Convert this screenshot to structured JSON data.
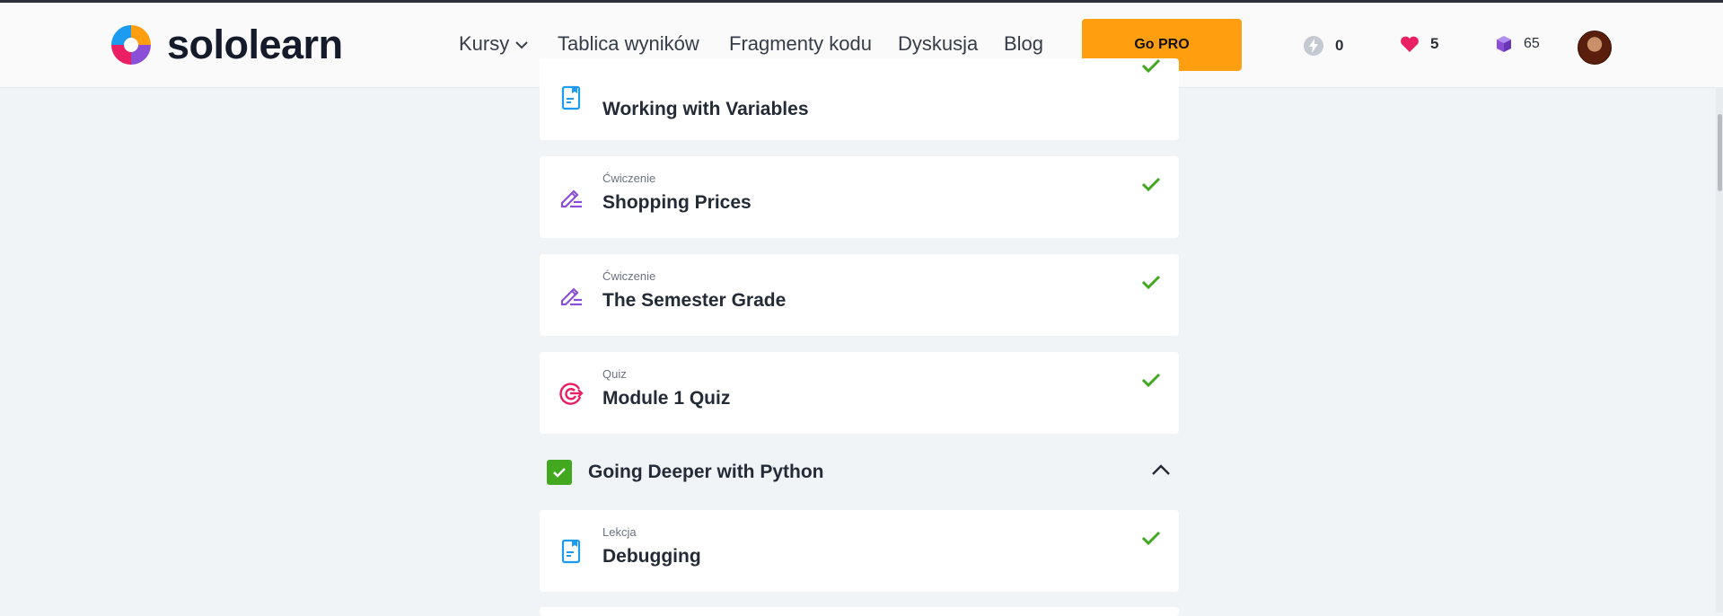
{
  "header": {
    "logo_text": "sololearn",
    "nav": [
      {
        "label": "Kursy",
        "has_dropdown": true
      },
      {
        "label": "Tablica wyników"
      },
      {
        "label": "Fragmenty kodu"
      },
      {
        "label": "Dyskusja"
      },
      {
        "label": "Blog"
      }
    ],
    "go_pro_label": "Go PRO",
    "stats": {
      "streak": "0",
      "hearts": "5",
      "bits": "65"
    }
  },
  "lessons": [
    {
      "type": "",
      "title": "Working with Variables",
      "icon": "lesson-icon",
      "completed": true
    },
    {
      "type": "Ćwiczenie",
      "title": "Shopping Prices",
      "icon": "pencil-icon",
      "completed": true
    },
    {
      "type": "Ćwiczenie",
      "title": "The Semester Grade",
      "icon": "pencil-icon",
      "completed": true
    },
    {
      "type": "Quiz",
      "title": "Module 1 Quiz",
      "icon": "target-icon",
      "completed": true
    }
  ],
  "module": {
    "title": "Going Deeper with Python",
    "completed": true,
    "expanded": true
  },
  "module_lessons": [
    {
      "type": "Lekcja",
      "title": "Debugging",
      "icon": "lesson-icon",
      "completed": true
    }
  ],
  "colors": {
    "accent_orange": "#ff9f0f",
    "check_green": "#42a820",
    "lesson_blue": "#1d9bf0",
    "exercise_purple": "#8a4fd6",
    "quiz_pink": "#e91e63"
  }
}
